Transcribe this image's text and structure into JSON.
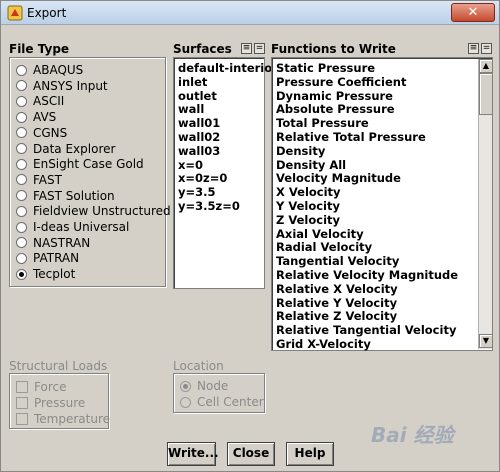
{
  "window": {
    "title": "Export",
    "close_glyph": "✕"
  },
  "file_type": {
    "label": "File Type",
    "options": [
      {
        "label": "ABAQUS",
        "checked": false
      },
      {
        "label": "ANSYS Input",
        "checked": false
      },
      {
        "label": "ASCII",
        "checked": false
      },
      {
        "label": "AVS",
        "checked": false
      },
      {
        "label": "CGNS",
        "checked": false
      },
      {
        "label": "Data Explorer",
        "checked": false
      },
      {
        "label": "EnSight Case Gold",
        "checked": false
      },
      {
        "label": "FAST",
        "checked": false
      },
      {
        "label": "FAST Solution",
        "checked": false
      },
      {
        "label": "Fieldview Unstructured",
        "checked": false
      },
      {
        "label": "I-deas Universal",
        "checked": false
      },
      {
        "label": "NASTRAN",
        "checked": false
      },
      {
        "label": "PATRAN",
        "checked": false
      },
      {
        "label": "Tecplot",
        "checked": true
      }
    ]
  },
  "surfaces": {
    "label": "Surfaces",
    "items": [
      "default-interior",
      "inlet",
      "outlet",
      "wall",
      "wall01",
      "wall02",
      "wall03",
      "x=0",
      "x=0z=0",
      "y=3.5",
      "y=3.5z=0"
    ]
  },
  "functions": {
    "label": "Functions to Write",
    "items": [
      "Static Pressure",
      "Pressure Coefficient",
      "Dynamic Pressure",
      "Absolute Pressure",
      "Total Pressure",
      "Relative Total Pressure",
      "Density",
      "Density All",
      "Velocity Magnitude",
      "X Velocity",
      "Y Velocity",
      "Z Velocity",
      "Axial Velocity",
      "Radial Velocity",
      "Tangential Velocity",
      "Relative Velocity Magnitude",
      "Relative X Velocity",
      "Relative Y Velocity",
      "Relative Z Velocity",
      "Relative Tangential Velocity",
      "Grid X-Velocity"
    ]
  },
  "list_buttons": {
    "select_all": "≡",
    "deselect_all": "="
  },
  "structural_loads": {
    "label": "Structural Loads",
    "options": [
      "Force",
      "Pressure",
      "Temperature"
    ]
  },
  "location": {
    "label": "Location",
    "options": [
      {
        "label": "Node",
        "checked": true
      },
      {
        "label": "Cell Center",
        "checked": false
      }
    ]
  },
  "buttons": {
    "write": "Write...",
    "close": "Close",
    "help": "Help"
  },
  "watermark": "Bai 经验",
  "colors": {
    "dialog_bg": "#d4d0c8",
    "titlebar": "#c8d8ec",
    "close_button": "#c44a2e",
    "disabled_text": "#8a8a8a"
  }
}
